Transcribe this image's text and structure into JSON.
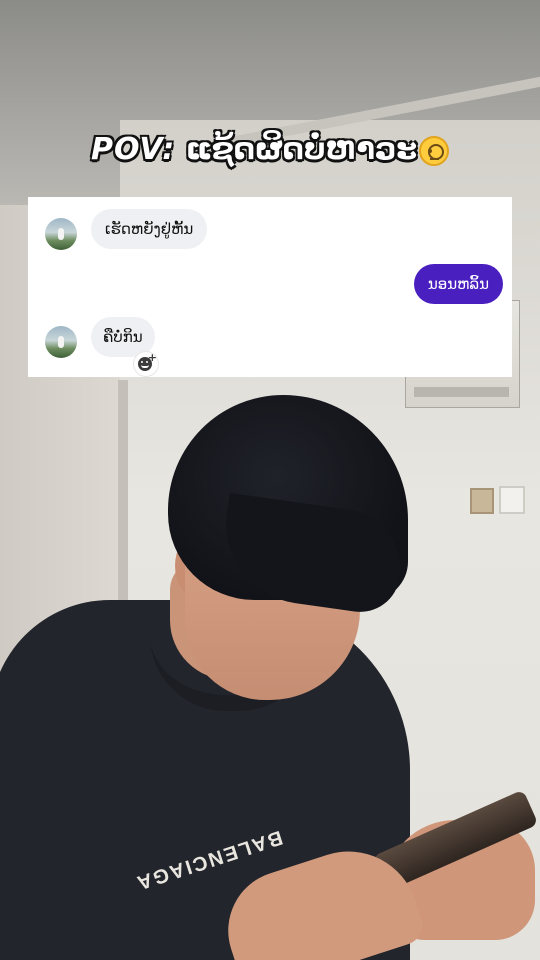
{
  "title": {
    "pov": "POV:",
    "text": " ແຊ້ດຜິດບໍ່ຫາວະ",
    "emoji_icon": "face-with-monocle-icon"
  },
  "background": {
    "shirt_print": "BALENCIAGA"
  },
  "chat": {
    "messages": [
      {
        "direction": "incoming",
        "text": "ເຮັດຫຍັງຢູ່ຫັ້ນ"
      },
      {
        "direction": "outgoing",
        "text": "ນອນຫລິ້ນ"
      },
      {
        "direction": "incoming",
        "text": "ຄືບໍ່ກິນ"
      }
    ],
    "colors": {
      "outgoing_bubble": "#4a1fc0",
      "incoming_bubble": "#eff0f3"
    }
  }
}
